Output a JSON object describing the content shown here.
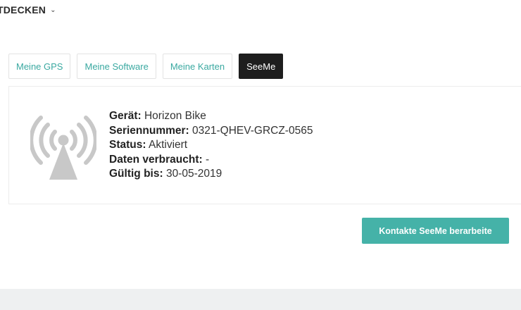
{
  "topnav": {
    "label": "TDECKEN",
    "chevron": "chevron-down-icon"
  },
  "tabs": [
    {
      "label": "Meine GPS",
      "active": false
    },
    {
      "label": "Meine Software",
      "active": false
    },
    {
      "label": "Meine Karten",
      "active": false
    },
    {
      "label": "SeeMe",
      "active": true
    }
  ],
  "device": {
    "icon": "antenna-signal-icon",
    "fields": [
      {
        "label": "Gerät:",
        "value": " Horizon Bike"
      },
      {
        "label": "Seriennummer:",
        "value": " 0321-QHEV-GRCZ-0565"
      },
      {
        "label": "Status:",
        "value": " Aktiviert"
      },
      {
        "label": "Daten verbraucht:",
        "value": " -"
      },
      {
        "label": "Gültig bis:",
        "value": " 30-05-2019"
      }
    ]
  },
  "action": {
    "label": "Kontakte SeeMe berarbeite"
  },
  "colors": {
    "accent": "#45b2a8",
    "tab_text": "#3aa9a1",
    "active_tab": "#1e1e1e",
    "icon_gray": "#c8c8c8"
  }
}
